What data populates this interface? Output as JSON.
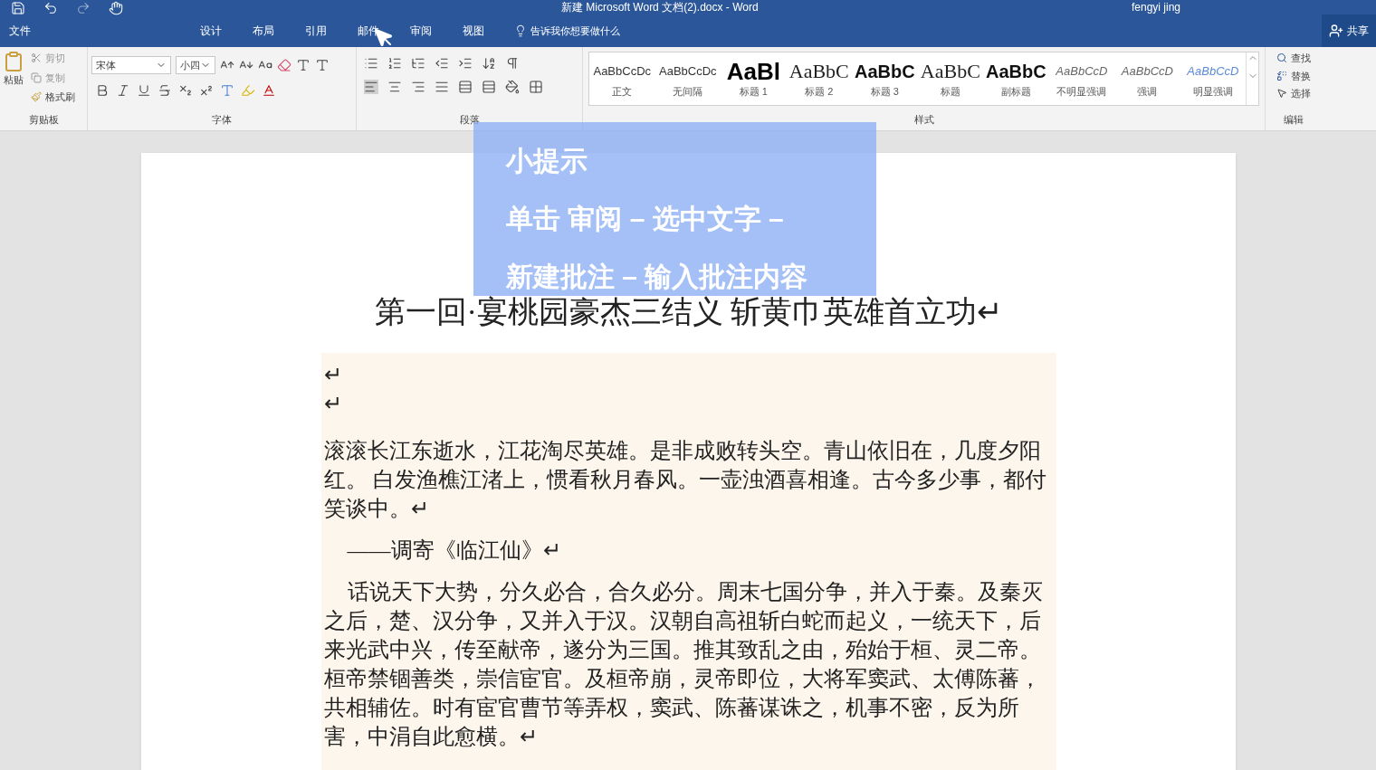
{
  "title_bar": {
    "title": "新建 Microsoft Word 文档(2).docx - Word",
    "user": "fengyi jing"
  },
  "tabs": [
    {
      "label": "文件"
    },
    {
      "label": "设计"
    },
    {
      "label": "布局"
    },
    {
      "label": "引用"
    },
    {
      "label": "邮件"
    },
    {
      "label": "审阅"
    },
    {
      "label": "视图"
    }
  ],
  "tell_me": "告诉我你想要做什么",
  "share": "共享",
  "clipboard": {
    "paste": "粘贴",
    "cut": "剪切",
    "copy": "复制",
    "format_painter": "格式刷",
    "label": "剪贴板"
  },
  "font": {
    "name": "宋体",
    "size": "小四",
    "label": "字体"
  },
  "paragraph": {
    "label": "段落"
  },
  "styles": {
    "label": "样式",
    "items": [
      {
        "preview": "AaBbCcDc",
        "name": "正文",
        "kind": "plain"
      },
      {
        "preview": "AaBbCcDc",
        "name": "无间隔",
        "kind": "plain"
      },
      {
        "preview": "AaBl",
        "name": "标题 1",
        "kind": "large"
      },
      {
        "preview": "AaBbC",
        "name": "标题 2",
        "kind": "serif"
      },
      {
        "preview": "AaBbC",
        "name": "标题 3",
        "kind": "bold"
      },
      {
        "preview": "AaBbC",
        "name": "标题",
        "kind": "serif"
      },
      {
        "preview": "AaBbC",
        "name": "副标题",
        "kind": "bold"
      },
      {
        "preview": "AaBbCcD",
        "name": "不明显强调",
        "kind": "italic"
      },
      {
        "preview": "AaBbCcD",
        "name": "强调",
        "kind": "italic"
      },
      {
        "preview": "AaBbCcD",
        "name": "明显强调",
        "kind": "accent"
      }
    ]
  },
  "editing": {
    "find": "查找",
    "replace": "替换",
    "select": "选择",
    "label": "编辑"
  },
  "document": {
    "heading": "第一回·宴桃园豪杰三结义  斩黄巾英雄首立功↵",
    "paragraphs": [
      {
        "text": "↵",
        "kind": "plain"
      },
      {
        "text": "↵",
        "kind": "plain"
      },
      {
        "text": "滚滚长江东逝水，江花淘尽英雄。是非成败转头空。青山依旧在，几度夕阳红。 白发渔樵江渚上，惯看秋月春风。一壶浊酒喜相逢。古今多少事，都付笑谈中。↵",
        "kind": "plain"
      },
      {
        "text": "——调寄《临江仙》↵",
        "kind": "indent"
      },
      {
        "text": "话说天下大势，分久必合，合久必分。周末七国分争，并入于秦。及秦灭之后，楚、汉分争，又并入于汉。汉朝自高祖斩白蛇而起义，一统天下，后来光武中兴，传至献帝，遂分为三国。推其致乱之由，殆始于桓、灵二帝。桓帝禁锢善类，崇信宦官。及桓帝崩，灵帝即位，大将军窦武、太傅陈蕃，共相辅佐。时有宦官曹节等弄权，窦武、陈蕃谋诛之，机事不密，反为所害，中涓自此愈横。↵",
        "kind": "indent"
      }
    ]
  },
  "tip": {
    "title": "小提示",
    "lines": [
      "单击 审阅 – 选中文字 –",
      "新建批注 – 输入批注内容"
    ]
  }
}
